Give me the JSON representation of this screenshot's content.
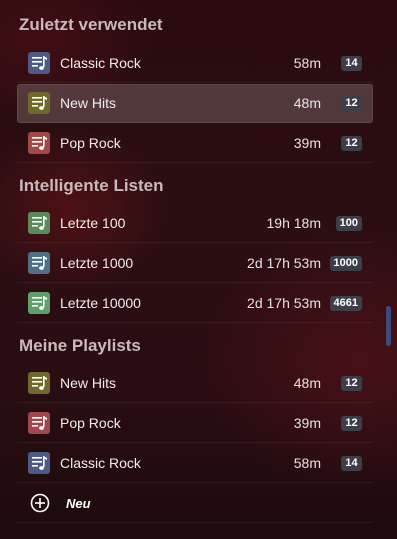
{
  "sections": {
    "recent": {
      "title": "Zuletzt verwendet",
      "items": [
        {
          "name": "Classic Rock",
          "duration": "58m",
          "count": "14",
          "color": "#4d5a86"
        },
        {
          "name": "New Hits",
          "duration": "48m",
          "count": "12",
          "color": "#6f6a2c",
          "selected": true
        },
        {
          "name": "Pop Rock",
          "duration": "39m",
          "count": "12",
          "color": "#a34848"
        }
      ]
    },
    "smart": {
      "title": "Intelligente Listen",
      "items": [
        {
          "name": "Letzte 100",
          "duration": "19h 18m",
          "count": "100",
          "color": "#5b8a58"
        },
        {
          "name": "Letzte 1000",
          "duration": "2d 17h 53m",
          "count": "1000",
          "color": "#4d6f87"
        },
        {
          "name": "Letzte 10000",
          "duration": "2d 17h 53m",
          "count": "4661",
          "color": "#5fa06a"
        }
      ]
    },
    "mine": {
      "title": "Meine Playlists",
      "items": [
        {
          "name": "New Hits",
          "duration": "48m",
          "count": "12",
          "color": "#6f6a2c"
        },
        {
          "name": "Pop Rock",
          "duration": "39m",
          "count": "12",
          "color": "#a34848"
        },
        {
          "name": "Classic Rock",
          "duration": "58m",
          "count": "14",
          "color": "#4d5a86"
        }
      ]
    }
  },
  "new_playlist": {
    "label": "Neu",
    "icon": "plus-circle-icon"
  },
  "colors": {
    "badge": "#3c3f48",
    "accent_scroll": "#3b4b7c"
  }
}
